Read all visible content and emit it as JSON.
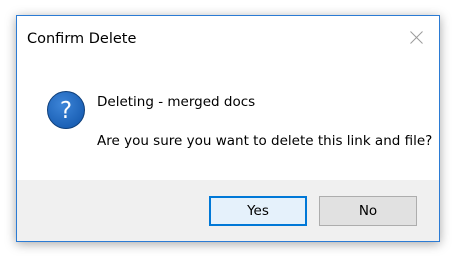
{
  "dialog": {
    "title": "Confirm Delete",
    "close_icon": "close-icon",
    "icon": "question-icon",
    "icon_color": "#1a5fb4",
    "line1": "Deleting - merged docs",
    "line2": "Are you sure you want to delete this link and file?"
  },
  "buttons": {
    "yes_label": "Yes",
    "no_label": "No"
  },
  "colors": {
    "accent": "#0078d7",
    "footer_bg": "#f0f0f0"
  }
}
